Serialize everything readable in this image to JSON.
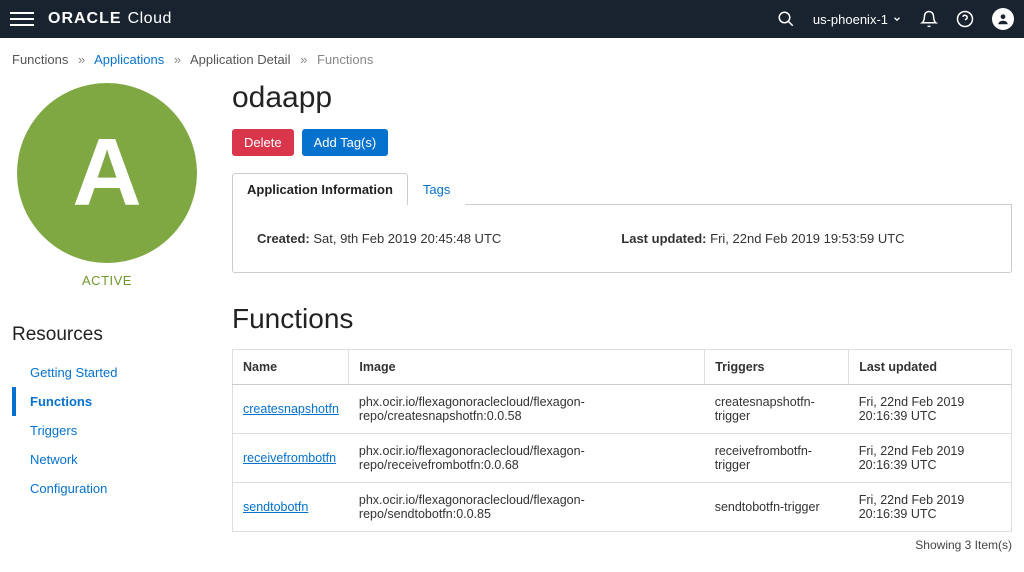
{
  "header": {
    "brand_strong": "ORACLE",
    "brand_light": "Cloud",
    "region": "us-phoenix-1"
  },
  "breadcrumb": {
    "items": [
      {
        "label": "Functions",
        "link": false
      },
      {
        "label": "Applications",
        "link": true
      },
      {
        "label": "Application Detail",
        "link": false
      },
      {
        "label": "Functions",
        "link": false,
        "current": true
      }
    ]
  },
  "app": {
    "avatar_letter": "A",
    "status": "ACTIVE",
    "title": "odaapp",
    "delete_label": "Delete",
    "add_tags_label": "Add Tag(s)"
  },
  "tabs": {
    "info_label": "Application Information",
    "tags_label": "Tags"
  },
  "info": {
    "created_label": "Created:",
    "created_value": "Sat, 9th Feb 2019 20:45:48 UTC",
    "updated_label": "Last updated:",
    "updated_value": "Fri, 22nd Feb 2019 19:53:59 UTC"
  },
  "resources": {
    "heading": "Resources",
    "items": [
      "Getting Started",
      "Functions",
      "Triggers",
      "Network",
      "Configuration"
    ],
    "active_index": 1
  },
  "functions": {
    "heading": "Functions",
    "columns": [
      "Name",
      "Image",
      "Triggers",
      "Last updated"
    ],
    "rows": [
      {
        "name": "createsnapshotfn",
        "image": "phx.ocir.io/flexagonoraclecloud/flexagon-repo/createsnapshotfn:0.0.58",
        "triggers": "createsnapshotfn-trigger",
        "last_updated": "Fri, 22nd Feb 2019 20:16:39 UTC"
      },
      {
        "name": "receivefrombotfn",
        "image": "phx.ocir.io/flexagonoraclecloud/flexagon-repo/receivefrombotfn:0.0.68",
        "triggers": "receivefrombotfn-trigger",
        "last_updated": "Fri, 22nd Feb 2019 20:16:39 UTC"
      },
      {
        "name": "sendtobotfn",
        "image": "phx.ocir.io/flexagonoraclecloud/flexagon-repo/sendtobotfn:0.0.85",
        "triggers": "sendtobotfn-trigger",
        "last_updated": "Fri, 22nd Feb 2019 20:16:39 UTC"
      }
    ],
    "showing": "Showing 3 Item(s)"
  }
}
